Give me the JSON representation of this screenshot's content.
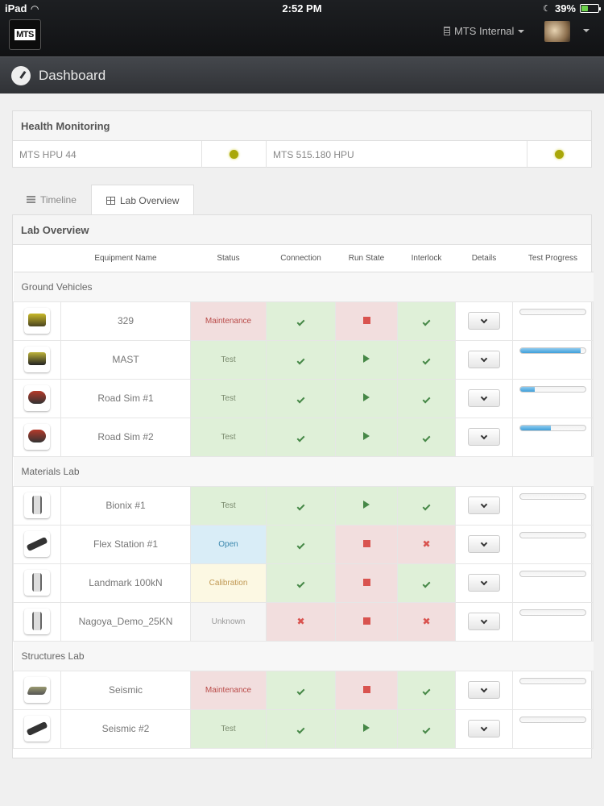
{
  "statusbar": {
    "carrier": "iPad",
    "time": "2:52 PM",
    "battery": "39%",
    "battery_level": 0.39
  },
  "header": {
    "logo": "MTS",
    "org": "MTS Internal"
  },
  "title": "Dashboard",
  "health": {
    "title": "Health Monitoring",
    "items": [
      {
        "name": "MTS HPU 44",
        "indicator": "#a9a70a"
      },
      {
        "name": "MTS 515.180 HPU",
        "indicator": "#a9a70a"
      }
    ]
  },
  "tabs": [
    {
      "label": "Timeline",
      "active": false
    },
    {
      "label": "Lab Overview",
      "active": true
    }
  ],
  "lab": {
    "title": "Lab Overview",
    "columns": [
      "",
      "Equipment Name",
      "Status",
      "Connection",
      "Run State",
      "Interlock",
      "Details",
      "Test Progress"
    ],
    "groups": [
      {
        "name": "Ground Vehicles",
        "rows": [
          {
            "thumb": "th-vehicle-yellow",
            "name": "329",
            "status": "Maintenance",
            "status_class": "st-maint",
            "connection": "ok",
            "run": "stop",
            "interlock": "ok",
            "progress": 0
          },
          {
            "thumb": "th-vehicle-dark",
            "name": "MAST",
            "status": "Test",
            "status_class": "st-test",
            "connection": "ok",
            "run": "play",
            "interlock": "ok",
            "progress": 0.92
          },
          {
            "thumb": "th-vehicle-red",
            "name": "Road Sim #1",
            "status": "Test",
            "status_class": "st-test",
            "connection": "ok",
            "run": "play",
            "interlock": "ok",
            "progress": 0.22
          },
          {
            "thumb": "th-vehicle-red",
            "name": "Road Sim #2",
            "status": "Test",
            "status_class": "st-test",
            "connection": "ok",
            "run": "play",
            "interlock": "ok",
            "progress": 0.47
          }
        ]
      },
      {
        "name": "Materials Lab",
        "rows": [
          {
            "thumb": "th-frame",
            "name": "Bionix #1",
            "status": "Test",
            "status_class": "st-test",
            "connection": "ok",
            "run": "play",
            "interlock": "ok",
            "progress": 0
          },
          {
            "thumb": "th-arm",
            "name": "Flex Station #1",
            "status": "Open",
            "status_class": "st-open",
            "connection": "ok",
            "run": "stop",
            "interlock": "bad",
            "progress": 0
          },
          {
            "thumb": "th-frame",
            "name": "Landmark 100kN",
            "status": "Calibration",
            "status_class": "st-calib",
            "connection": "ok",
            "run": "stop",
            "interlock": "ok",
            "progress": 0
          },
          {
            "thumb": "th-frame",
            "name": "Nagoya_Demo_25KN",
            "status": "Unknown",
            "status_class": "st-unknown",
            "connection": "bad",
            "run": "stop",
            "interlock": "bad",
            "progress": 0
          }
        ]
      },
      {
        "name": "Structures Lab",
        "rows": [
          {
            "thumb": "th-table",
            "name": "Seismic",
            "status": "Maintenance",
            "status_class": "st-maint",
            "connection": "ok",
            "run": "stop",
            "interlock": "ok",
            "progress": 0
          },
          {
            "thumb": "th-arm",
            "name": "Seismic #2",
            "status": "Test",
            "status_class": "st-test",
            "connection": "ok",
            "run": "play",
            "interlock": "ok",
            "progress": 0
          }
        ]
      }
    ]
  }
}
